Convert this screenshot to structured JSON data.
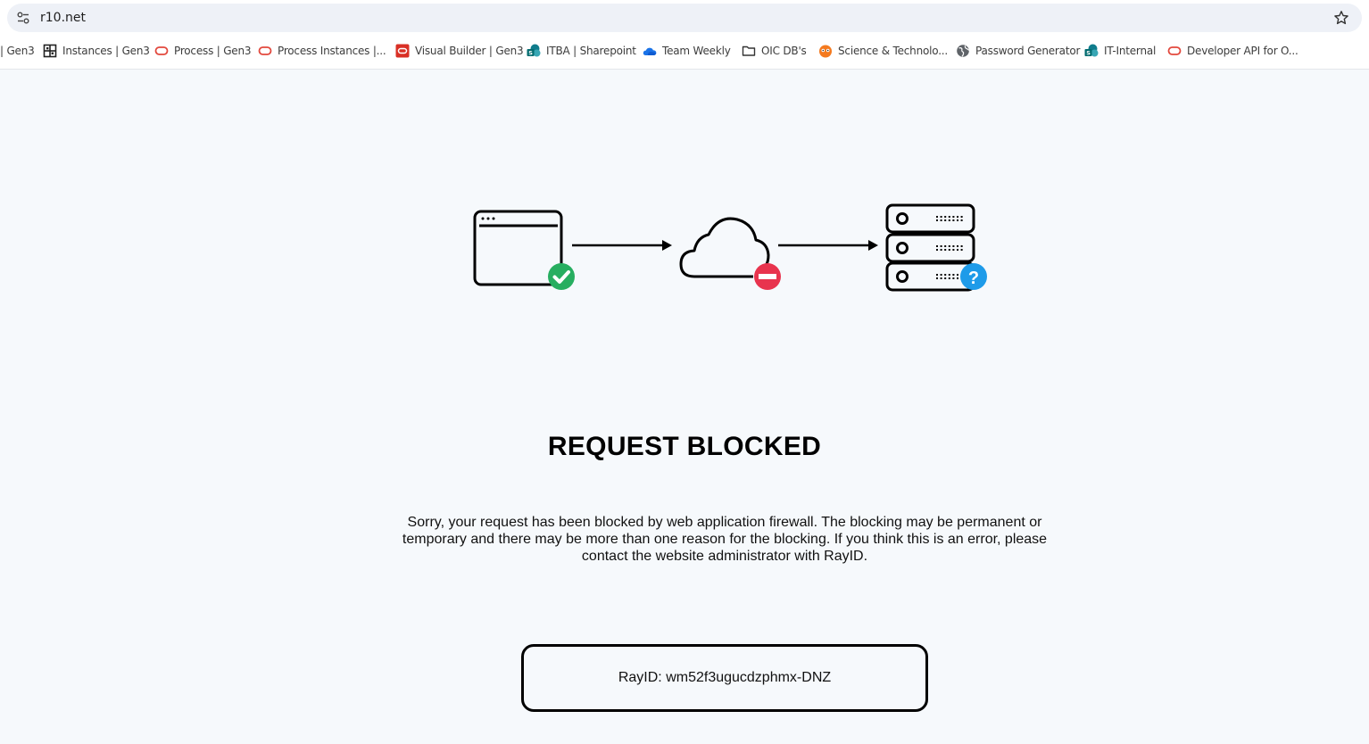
{
  "browser": {
    "url": "r10.net",
    "icons": {
      "site_settings": "tune-icon",
      "bookmark_star": "star-icon"
    }
  },
  "bookmarks": [
    {
      "label": "| Gen3",
      "icon": "none"
    },
    {
      "label": "Instances | Gen3",
      "icon": "grid-icon"
    },
    {
      "label": "Process | Gen3",
      "icon": "oracle-icon"
    },
    {
      "label": "Process Instances |...",
      "icon": "oracle-icon"
    },
    {
      "label": "Visual Builder | Gen3",
      "icon": "oracle-square-icon"
    },
    {
      "label": "ITBA | Sharepoint",
      "icon": "sharepoint-icon"
    },
    {
      "label": "Team Weekly",
      "icon": "onedrive-cloud-icon"
    },
    {
      "label": "OIC DB's",
      "icon": "folder-icon"
    },
    {
      "label": "Science & Technolo...",
      "icon": "orange-face-icon"
    },
    {
      "label": "Password Generator",
      "icon": "globe-icon"
    },
    {
      "label": "IT-Internal",
      "icon": "sharepoint-icon"
    },
    {
      "label": "Developer API for O...",
      "icon": "oracle-icon"
    }
  ],
  "page": {
    "title": "REQUEST BLOCKED",
    "message": "Sorry, your request has been blocked by web application firewall. The blocking may be permanent or temporary and there may be more than one reason for the blocking. If you think this is an error, please contact the website administrator with RayID.",
    "ray_id": "RayID: wm52f3ugucdzphmx-DNZ"
  },
  "colors": {
    "success": "#27ae60",
    "blocked": "#e8344e",
    "question": "#1e9be9",
    "oracle_red": "#e2483d"
  }
}
